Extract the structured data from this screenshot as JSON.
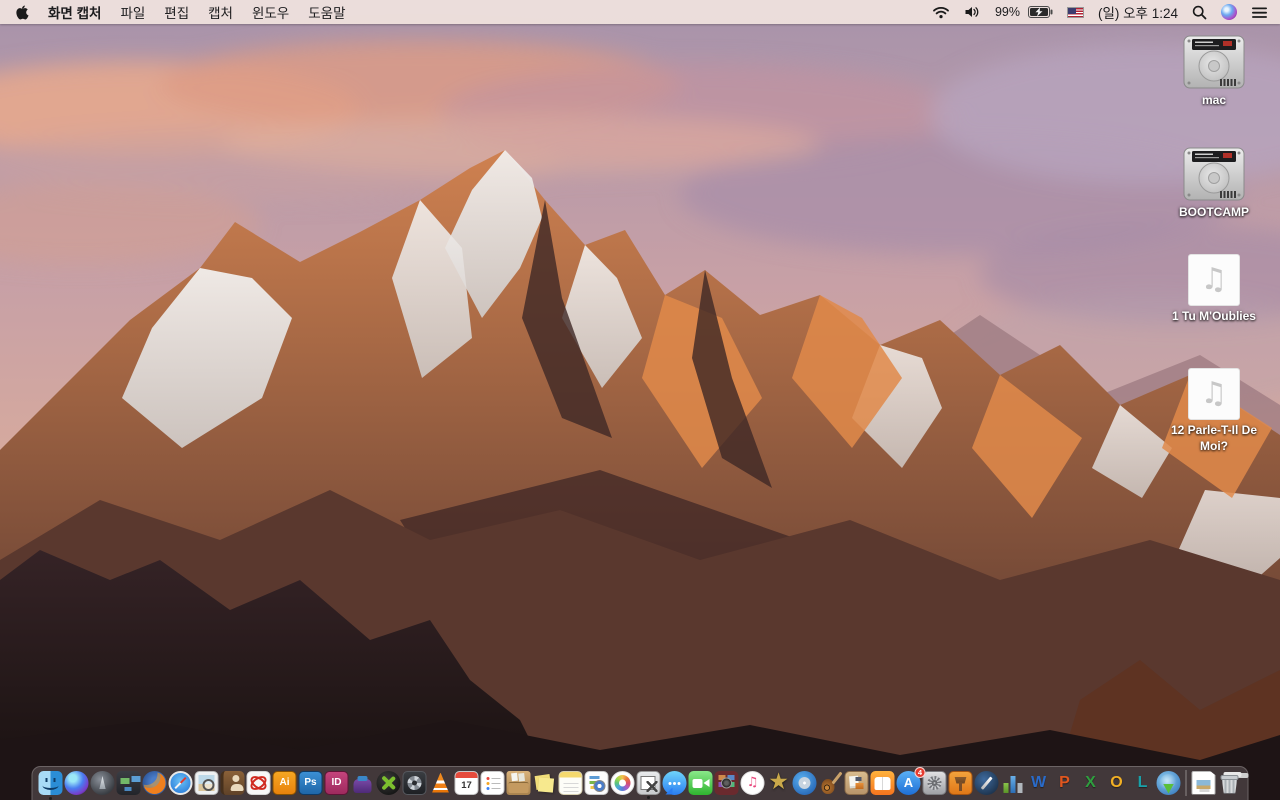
{
  "menu_bar": {
    "app_menu": "화면 캡처",
    "menus": [
      "파일",
      "편집",
      "캡처",
      "윈도우",
      "도움말"
    ],
    "status": {
      "battery_percent": "99%",
      "clock": "(일) 오후 1:24"
    },
    "status_icons": [
      "wifi-icon",
      "volume-icon",
      "battery-charging-icon",
      "us-flag-icon",
      "spotlight-search-icon",
      "siri-icon",
      "notification-center-icon"
    ],
    "colors": {
      "bar_background": "#EDDFDC",
      "text": "#1C1C1E"
    }
  },
  "desktop": {
    "icons": [
      {
        "label": "mac",
        "type": "hard-drive-icon"
      },
      {
        "label": "BOOTCAMP",
        "type": "hard-drive-icon"
      },
      {
        "label": "1 Tu M'Oublies",
        "type": "audio-file-icon"
      },
      {
        "label": "12 Parle-T-Il De Moi?",
        "type": "audio-file-icon"
      }
    ]
  },
  "dock": {
    "items": [
      {
        "name": "finder",
        "running": true
      },
      {
        "name": "siri"
      },
      {
        "name": "launchpad"
      },
      {
        "name": "mission-control"
      },
      {
        "name": "firefox"
      },
      {
        "name": "safari"
      },
      {
        "name": "preview"
      },
      {
        "name": "contacts"
      },
      {
        "name": "acrobat-reader"
      },
      {
        "name": "illustrator",
        "glyph": "Ai"
      },
      {
        "name": "photoshop",
        "glyph": "Ps"
      },
      {
        "name": "indesign",
        "glyph": "ID"
      },
      {
        "name": "toast-titanium"
      },
      {
        "name": "media-player-x"
      },
      {
        "name": "fan-utility"
      },
      {
        "name": "vlc"
      },
      {
        "name": "calendar",
        "glyph": "17"
      },
      {
        "name": "reminders"
      },
      {
        "name": "archive-box-app"
      },
      {
        "name": "stickies"
      },
      {
        "name": "notes"
      },
      {
        "name": "document-viewer-app"
      },
      {
        "name": "photos"
      },
      {
        "name": "grab-screen-capture",
        "running": true
      },
      {
        "name": "messages"
      },
      {
        "name": "facetime"
      },
      {
        "name": "photo-booth"
      },
      {
        "name": "itunes"
      },
      {
        "name": "imovie-09"
      },
      {
        "name": "dvd-ripper"
      },
      {
        "name": "garageband"
      },
      {
        "name": "page-layout-app"
      },
      {
        "name": "ibooks"
      },
      {
        "name": "app-store",
        "glyph": "A",
        "badge": "4"
      },
      {
        "name": "system-preferences"
      },
      {
        "name": "keynote-09"
      },
      {
        "name": "pages-09"
      },
      {
        "name": "numbers-09"
      },
      {
        "name": "word",
        "glyph": "W"
      },
      {
        "name": "powerpoint",
        "glyph": "P"
      },
      {
        "name": "excel",
        "glyph": "X"
      },
      {
        "name": "outlook",
        "glyph": "O"
      },
      {
        "name": "lync",
        "glyph": "L"
      },
      {
        "name": "video-downloader"
      },
      {
        "separator": true
      },
      {
        "name": "image-document-file"
      },
      {
        "name": "trash-full"
      }
    ]
  }
}
